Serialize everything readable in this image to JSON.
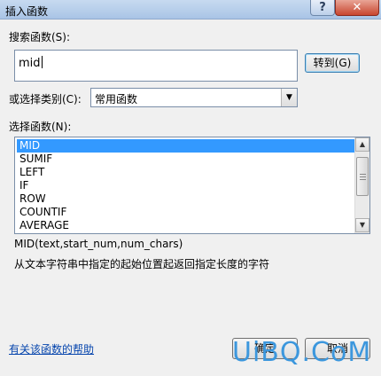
{
  "window": {
    "title": "插入函数",
    "help_label": "?",
    "close_label": "✕"
  },
  "search": {
    "label": "搜索函数(S):",
    "value": "mid",
    "go_button": "转到(G)"
  },
  "category": {
    "label": "或选择类别(C):",
    "selected": "常用函数"
  },
  "function_list": {
    "label": "选择函数(N):",
    "items": [
      "MID",
      "SUMIF",
      "LEFT",
      "IF",
      "ROW",
      "COUNTIF",
      "AVERAGE"
    ],
    "selected_index": 0
  },
  "detail": {
    "syntax": "MID(text,start_num,num_chars)",
    "description": "从文本字符串中指定的起始位置起返回指定长度的字符"
  },
  "footer": {
    "help_link": "有关该函数的帮助",
    "ok_label": "确定",
    "cancel_label": "取消"
  },
  "watermark": "UiBQ.CoM",
  "colors": {
    "selection": "#3399ff",
    "link": "#0645ad",
    "watermark": "#3c97dd"
  }
}
